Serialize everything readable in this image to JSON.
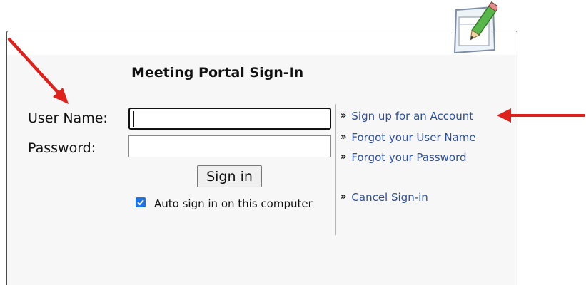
{
  "login": {
    "title": "Meeting Portal Sign-In",
    "username_label": "User Name:",
    "password_label": "Password:",
    "username_value": "",
    "password_value": "",
    "signin_button": "Sign in",
    "auto_signin_label": "Auto sign in on this computer",
    "auto_signin_checked": true
  },
  "links": {
    "chevron": "»",
    "signup": "Sign up for an Account",
    "forgot_username": "Forgot your User Name",
    "forgot_password": "Forgot your Password",
    "cancel": "Cancel Sign-in"
  },
  "annotations": {
    "arrow_color": "#e0201b"
  },
  "icons": {
    "header_icon": "notepad-pencil-icon"
  },
  "colors": {
    "link": "#2c4f9e",
    "checkbox": "#1a73e8",
    "panel_bg": "#f7f7f7"
  }
}
